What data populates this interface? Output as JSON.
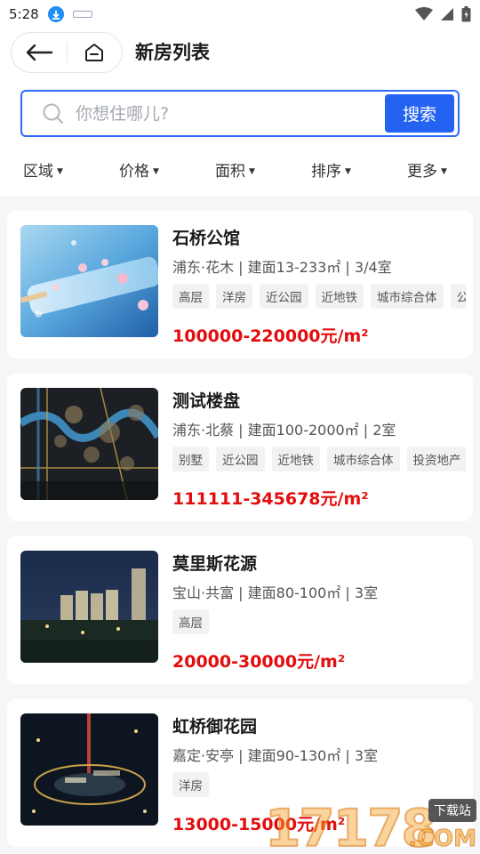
{
  "status_bar": {
    "time": "5:28"
  },
  "header": {
    "title": "新房列表"
  },
  "search": {
    "placeholder": "你想住哪儿?",
    "value": "",
    "button_label": "搜索"
  },
  "filters": [
    {
      "label": "区域"
    },
    {
      "label": "价格"
    },
    {
      "label": "面积"
    },
    {
      "label": "排序"
    },
    {
      "label": "更多"
    }
  ],
  "listings": [
    {
      "name": "石桥公馆",
      "meta": "浦东·花木 | 建面13-233㎡ | 3/4室",
      "tags": [
        "高层",
        "洋房",
        "近公园",
        "近地铁",
        "城市综合体",
        "公积"
      ],
      "price": "100000-220000元/m²",
      "image_icon": "popsicle-photo"
    },
    {
      "name": "测试楼盘",
      "meta": "浦东·北蔡 | 建面100-2000㎡ | 2室",
      "tags": [
        "别墅",
        "近公园",
        "近地铁",
        "城市综合体",
        "投资地产"
      ],
      "price": "111111-345678元/m²",
      "image_icon": "city-map-photo"
    },
    {
      "name": "莫里斯花源",
      "meta": "宝山·共富 | 建面80-100㎡ | 3室",
      "tags": [
        "高层"
      ],
      "price": "20000-30000元/m²",
      "image_icon": "night-towers-photo"
    },
    {
      "name": "虹桥御花园",
      "meta": "嘉定·安亭 | 建面90-130㎡ | 3室",
      "tags": [
        "洋房"
      ],
      "price": "13000-15000元/m²",
      "image_icon": "night-plaza-photo"
    }
  ],
  "watermark": {
    "number": "17178",
    "tag": "下载站",
    "suffix": ".COM"
  },
  "colors": {
    "accent": "#2463f2",
    "price": "#e30d0d"
  }
}
